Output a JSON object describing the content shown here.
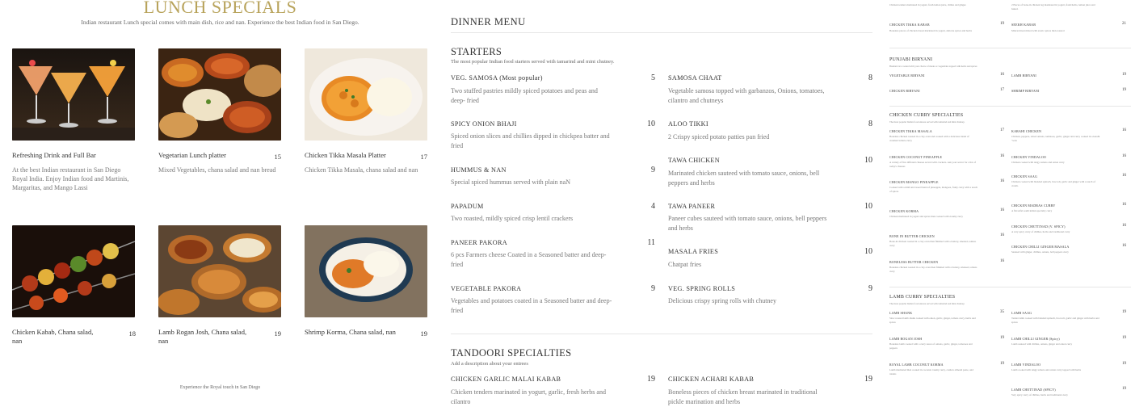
{
  "lunch": {
    "title": "LUNCH SPECIALS",
    "subtitle": "Indian restaurant Lunch special comes with main dish, rice and nan. Experience the best Indian food in San Diego.",
    "footer": "Experience the Royal touch in San Diego",
    "items": [
      {
        "name": "Refreshing Drink and Full Bar",
        "price": "",
        "desc": "At the best Indian restaurant in San Diego Royal India. Enjoy Indian food and Martinis, Margaritas, and Mango Lassi",
        "photo": "cocktails"
      },
      {
        "name": "Vegetarian Lunch platter",
        "price": "15",
        "desc": "Mixed Vegetables, chana salad and nan bread",
        "photo": "veg-platter"
      },
      {
        "name": "Chicken Tikka Masala Platter",
        "price": "17",
        "desc": "Chicken Tikka Masala, chana salad and nan",
        "photo": "tikka-masala"
      },
      {
        "name": "Chicken Kabab, Chana salad, nan",
        "price": "18",
        "desc": "",
        "photo": "kabab"
      },
      {
        "name": "Lamb Rogan Josh, Chana salad, nan",
        "price": "19",
        "desc": "",
        "photo": "rogan-josh"
      },
      {
        "name": "Shrimp Korma, Chana salad, nan",
        "price": "19",
        "desc": "",
        "photo": "shrimp-korma"
      }
    ]
  },
  "dinner": {
    "title": "DINNER MENU",
    "starters": {
      "title": "STARTERS",
      "subtitle": "The most popular Indian food starters served with tamarind and mint chutney.",
      "left": [
        {
          "name": "VEG. SAMOSA (Most popular)",
          "price": "5",
          "desc": "Two  stuffed pastries mildly spiced potatoes and peas and deep- fried"
        },
        {
          "name": "SPICY ONION BHAJI",
          "price": "10",
          "desc": "Spiced onion slices and chillies dipped in chickpea batter and fried"
        },
        {
          "name": "HUMMUS & NAN",
          "price": "9",
          "desc": "Special spiced hummus served with plain naN"
        },
        {
          "name": "PAPADUM",
          "price": "4",
          "desc": "Two roasted, mildly spiced crisp lentil crackers"
        },
        {
          "name": "PANEER PAKORA",
          "price": "11",
          "desc": "6 pcs Farmers cheese Coated in a Seasoned batter and deep-fried"
        },
        {
          "name": "VEGETABLE PAKORA",
          "price": "9",
          "desc": "Vegetables and potatoes coated in a Seasoned batter and deep-fried"
        }
      ],
      "right": [
        {
          "name": "SAMOSA CHAAT",
          "price": "8",
          "desc": "Vegetable samosa topped with garbanzos, Onions, tomatoes, cilantro and chutneys"
        },
        {
          "name": "ALOO TIKKI",
          "price": "8",
          "desc": "2 Crispy spiced potato patties pan fried"
        },
        {
          "name": "TAWA CHICKEN",
          "price": "10",
          "desc": "Marinated chicken sauteed with tomato  sauce, onions, bell peppers  and herbs"
        },
        {
          "name": "TAWA PANEER",
          "price": "10",
          "desc": "Paneer cubes  sauteed with tomato  sauce, onions,  bell peppers and herbs"
        },
        {
          "name": "MASALA FRIES",
          "price": "10",
          "desc": "Chatpat fries"
        },
        {
          "name": "VEG. SPRING ROLLS",
          "price": "9",
          "desc": "Delicious crispy spring rolls with chutney"
        }
      ]
    },
    "tandoori": {
      "title": "TANDOORI SPECIALTIES",
      "subtitle": "Add a description about your entrees",
      "left": [
        {
          "name": "CHICKEN GARLIC MALAI KABAB",
          "price": "19",
          "desc": "Chicken tenders marinated in yogurt, garlic, fresh herbs and cilantro"
        }
      ],
      "right": [
        {
          "name": "CHICKEN ACHARI KABAB",
          "price": "19",
          "desc": "Boneless pieces of chicken breast marinated in traditional pickle marination and herbs"
        }
      ]
    }
  },
  "side": {
    "top_left": [
      {
        "name": "",
        "price": "",
        "desc": "Chicken tenders marinated in yogurt, fresh lemon juice, chilies and ginger."
      },
      {
        "name": "CHICKEN TIKKA KABAB",
        "price": "19",
        "desc": "Boneless pieces of chicken breast marinated in yogurt, delicate spices and herbs"
      }
    ],
    "top_right": [
      {
        "name": "",
        "price": "",
        "desc": "2 Pieces of bone-in chicken leg marinated in yogurt, fresh herbs, lemon juice and baked."
      },
      {
        "name": "SEEKH KABAB",
        "price": "21",
        "desc": "Minced meat mixed with exotic spices then roasted"
      }
    ],
    "biryani": {
      "title": "PUNJABI BIRYANI",
      "subtitle": "Basmati rice cooked with your choice of meats or vegetables topped with herbs and spices",
      "left": [
        {
          "name": "VEGETABLE BIRYANI",
          "price": "16"
        },
        {
          "name": "CHICKEN BIRYANI",
          "price": "17"
        }
      ],
      "right": [
        {
          "name": "LAMB BIRYANI",
          "price": "19"
        },
        {
          "name": "SHRIMP BIRYANI",
          "price": "19"
        }
      ]
    },
    "chicken_curry": {
      "title": "CHICKEN CURRY SPECIALTIES",
      "subtitle": "The most popular Indian food entrees served with tamarind and mint chutney.",
      "left": [
        {
          "name": "CHICKEN TIKKA MASALA",
          "price": "17",
          "desc": "Boneless chicken roasted in a clay oven and cooked with a delicious blend of creamed tomato curry"
        },
        {
          "name": "CHICKEN COCONUT PINEAPPLE",
          "price": "16",
          "desc": "A variety of five different cheeses served with crackers. Ask your server for a list of today's cheeses"
        },
        {
          "name": "CHICKEN MANGO PINEAPPLE",
          "price": "16",
          "desc": "Cooked with a mild and sweet blend of pineapple, mangoes, fruity curry with a touch of spices"
        },
        {
          "name": "CHICKEN KORMA",
          "price": "16",
          "desc": "Chicken marinated in yogurt and spices then cooked with creamy curry"
        },
        {
          "name": "BONE IN BUTTER CHICKEN",
          "price": "16",
          "desc": "Bone-in chicken roasted in a clay oven then finished with a buttery, smoked, tomato curry"
        },
        {
          "name": "BONELESS BUTTER CHICKEN",
          "price": "16",
          "desc": "Boneless chicken roasted in a clay oven then finished with a buttery, smoked, tomato curry"
        }
      ],
      "right": [
        {
          "name": "KARAHI CHICKEN",
          "price": "16",
          "desc": "Chicken, peppers, sliced onions, tomatoes, garlic, ginger and curry cooked in a karahi \"wok"
        },
        {
          "name": "CHICKEN VINDALOO",
          "price": "16",
          "desc": "Chicken cooked with tangy tomato and onion curry"
        },
        {
          "name": "CHICKEN SAAG",
          "price": "16",
          "desc": "Chicken cooked with blended spinach, broccoli, garlic and ginger with a touch of cream."
        },
        {
          "name": "CHICKEN MADRAS CURRY",
          "price": "16",
          "desc": "A flavorful south indian specialty curry"
        },
        {
          "name": "CHICKEN CHETTINAD (V. SPICY)",
          "price": "16",
          "desc": "A very spicy curry of chillies, herbs and traditional curry"
        },
        {
          "name": "CHICKEN CHILLI GINGER MASALA",
          "price": "16",
          "desc": "Sauteed with ginger, chillies, onions, bell peppers curry"
        }
      ]
    },
    "lamb_curry": {
      "title": "LAMB CURRY SPECIALTIES",
      "subtitle": "The most popular Indian food entrees served with tamarind and mint chutney.",
      "left": [
        {
          "name": "LAMB SHANK",
          "price": "35",
          "desc": "Slow roasted lamb shank cooked with onion, garlic, ginger, tomato curry, herbs and spices"
        },
        {
          "name": "LAMB ROGAN JOSH",
          "price": "19",
          "desc": "Boneless lamb cooked with a curry sauce of onions, garlic, ginger, tomatoes and peppers"
        },
        {
          "name": "ROYAL LAMB COCONUT KORMA",
          "price": "19",
          "desc": "Lamb marinated then cooked in coconut creamy curry, cashew almond paste, and raisins"
        }
      ],
      "right": [
        {
          "name": "LAMB SAAG",
          "price": "19",
          "desc": "Tender lamb cooked with blended  spinach, broccoli, garlic and ginger with herbs and spices"
        },
        {
          "name": "LAMB CHILLI GINGER (Spicy)",
          "price": "19",
          "desc": "Lamb sauteed with chillies, onions, ginger and onion curry"
        },
        {
          "name": "LAMB VINDALOO",
          "price": "19",
          "desc": "Lamb cooked with tangy tomato and onion curry topped with herbs"
        },
        {
          "name": "LAMB CHETTINAD (SPICY)",
          "price": "19",
          "desc": "Very spicy curry of chillies, herbs and traditional curry"
        }
      ]
    }
  }
}
